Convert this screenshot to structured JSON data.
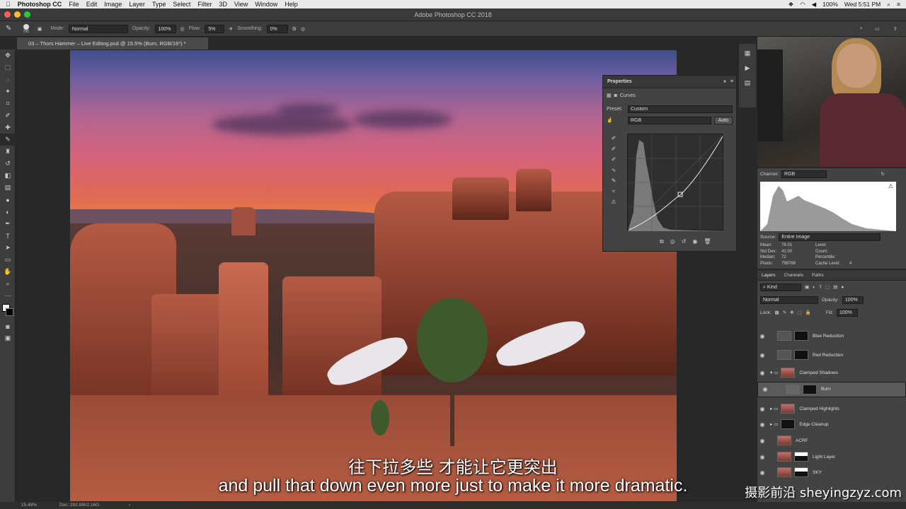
{
  "menubar": {
    "apple": "",
    "app_name": "Photoshop CC",
    "items": [
      "File",
      "Edit",
      "Image",
      "Layer",
      "Type",
      "Select",
      "Filter",
      "3D",
      "View",
      "Window",
      "Help"
    ],
    "battery": "100%",
    "clock": "Wed 5:51 PM"
  },
  "window": {
    "title": "Adobe Photoshop CC 2018"
  },
  "options": {
    "brush_size": "795",
    "mode_label": "Mode:",
    "mode_value": "Normal",
    "opacity_label": "Opacity:",
    "opacity_value": "100%",
    "flow_label": "Flow:",
    "flow_value": "5%",
    "smoothing_label": "Smoothing:",
    "smoothing_value": "0%"
  },
  "document": {
    "tab_title": "03 – Thors Hammer – Live Editing.psd @ 15.5% (Burn, RGB/16*) *"
  },
  "properties": {
    "panel_title": "Properties",
    "adjustment": "Curves",
    "preset_label": "Preset:",
    "preset_value": "Custom",
    "channel_value": "RGB",
    "auto_label": "Auto"
  },
  "histogram": {
    "channel_label": "Channel:",
    "channel_value": "RGB",
    "source_label": "Source:",
    "source_value": "Entire Image",
    "stats": [
      [
        "Mean:",
        "76.01",
        "Level:",
        ""
      ],
      [
        "Std Dev:",
        "41.00",
        "Count:",
        ""
      ],
      [
        "Median:",
        "72",
        "Percentile:",
        ""
      ],
      [
        "Pixels:",
        "798768",
        "Cache Level:",
        "4"
      ]
    ]
  },
  "layers": {
    "tabs": [
      "Layers",
      "Channels",
      "Paths"
    ],
    "filter_kind": "Kind",
    "blend_mode": "Normal",
    "opacity_label": "Opacity:",
    "opacity_value": "100%",
    "lock_label": "Lock:",
    "fill_label": "Fill:",
    "fill_value": "100%",
    "items": [
      {
        "name": "Blue Reduction"
      },
      {
        "name": "Red Reduction"
      },
      {
        "name": "Clamped Shadows"
      },
      {
        "name": "Burn"
      },
      {
        "name": "Clamped Highlights"
      },
      {
        "name": "Edge Cleanup"
      },
      {
        "name": "ACRF"
      },
      {
        "name": "Light Layer"
      },
      {
        "name": "SKY"
      }
    ]
  },
  "status": {
    "zoom": "15.49%",
    "doc": "Doc: 292.8M/2.16G"
  },
  "subtitles": {
    "chinese": "往下拉多些 才能让它更突出",
    "english": "and pull that down even more just to make it more dramatic."
  },
  "watermark": "摄影前沿 sheyingzyz.com"
}
